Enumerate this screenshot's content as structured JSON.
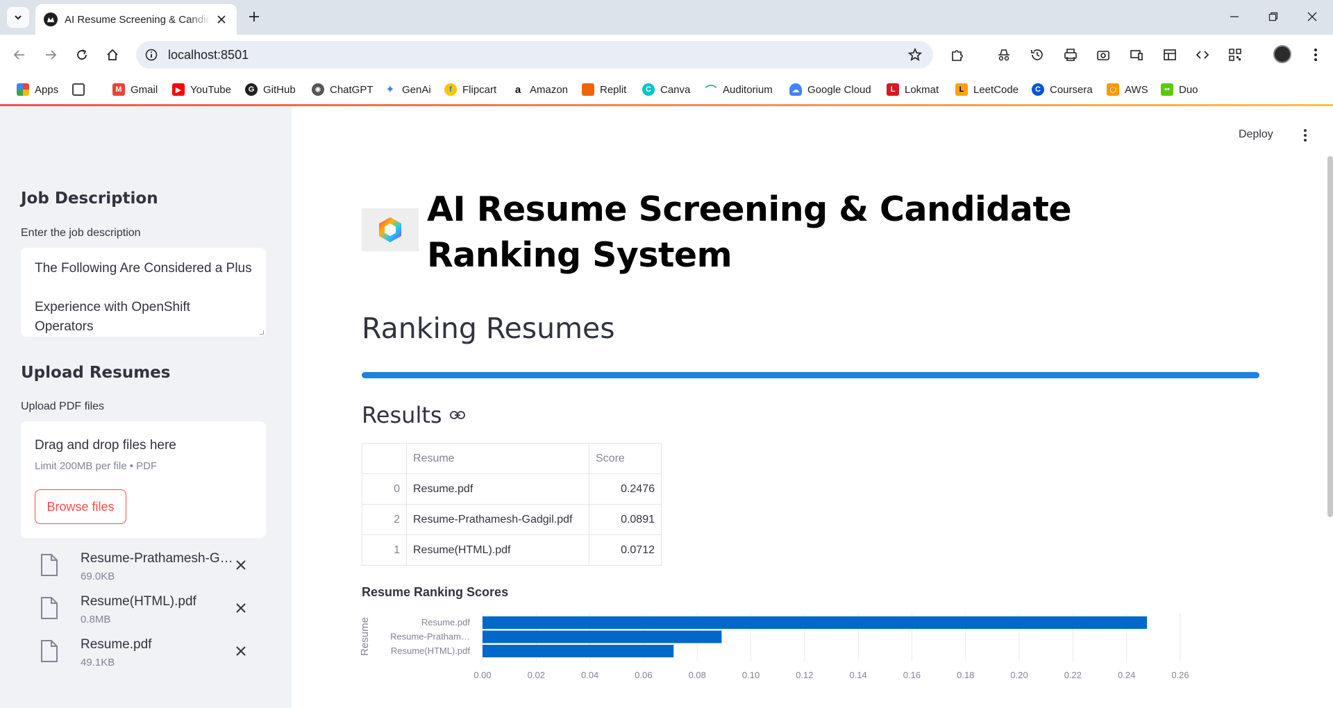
{
  "browser": {
    "tab_title": "AI Resume Screening & Candidate Ranking System",
    "url": "localhost:8501",
    "bookmarks": [
      "Apps",
      "Gmail",
      "YouTube",
      "GitHub",
      "ChatGPT",
      "GenAi",
      "Flipcart",
      "Amazon",
      "Replit",
      "Canva",
      "Auditorium",
      "Google Cloud",
      "Lokmat",
      "LeetCode",
      "Coursera",
      "AWS",
      "Duo"
    ]
  },
  "sidebar": {
    "job_heading": "Job Description",
    "job_label": "Enter the job description",
    "job_text_line1": "The Following Are Considered a Plus",
    "job_text_line2": "Experience with OpenShift Operators",
    "upload_heading": "Upload Resumes",
    "upload_label": "Upload PDF files",
    "dropzone_title": "Drag and drop files here",
    "dropzone_limit": "Limit 200MB per file • PDF",
    "browse_label": "Browse files",
    "files": [
      {
        "name": "Resume-Prathamesh-Gadgil.pdf",
        "size": "69.0KB"
      },
      {
        "name": "Resume(HTML).pdf",
        "size": "0.8MB"
      },
      {
        "name": "Resume.pdf",
        "size": "49.1KB"
      }
    ]
  },
  "main": {
    "deploy_label": "Deploy",
    "title": "AI Resume Screening & Candidate Ranking System",
    "ranking_heading": "Ranking Resumes",
    "progress": 1.0,
    "results_heading": "Results",
    "table": {
      "headers": [
        "",
        "Resume",
        "Score"
      ],
      "rows": [
        {
          "index": "0",
          "resume": "Resume.pdf",
          "score": "0.2476"
        },
        {
          "index": "2",
          "resume": "Resume-Prathamesh-Gadgil.pdf",
          "score": "0.0891"
        },
        {
          "index": "1",
          "resume": "Resume(HTML).pdf",
          "score": "0.0712"
        }
      ]
    },
    "chart_title": "Resume Ranking Scores"
  },
  "chart_data": {
    "type": "bar",
    "orientation": "horizontal",
    "title": "Resume Ranking Scores",
    "ylabel": "Resume",
    "xlabel": "",
    "categories": [
      "Resume.pdf",
      "Resume-Pratham…",
      "Resume(HTML).pdf"
    ],
    "values": [
      0.2476,
      0.0891,
      0.0712
    ],
    "xlim": [
      0,
      0.26
    ],
    "xticks": [
      "0.00",
      "0.02",
      "0.04",
      "0.06",
      "0.08",
      "0.10",
      "0.12",
      "0.14",
      "0.16",
      "0.18",
      "0.20",
      "0.22",
      "0.24",
      "0.26"
    ],
    "grid": true,
    "bar_color": "#0068c9"
  }
}
